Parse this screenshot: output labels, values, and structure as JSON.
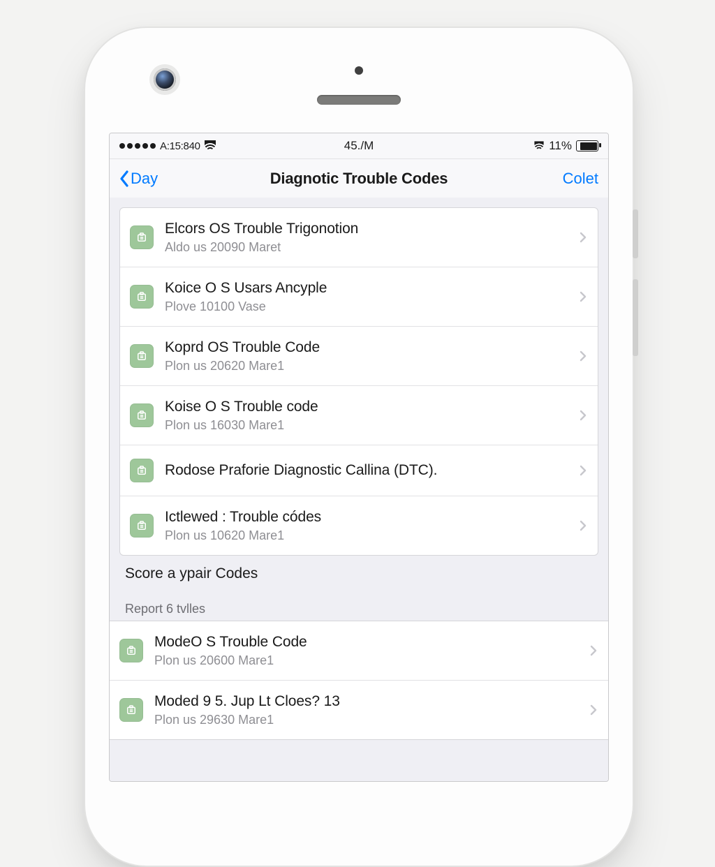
{
  "status": {
    "carrier": "A:15:840",
    "time": "45./M",
    "battery": "11%"
  },
  "nav": {
    "back": "Day",
    "title": "Diagnotic Trouble Codes",
    "right": "Colet"
  },
  "section1": {
    "items": [
      {
        "title": "Elcors OS Trouble Trigonotion",
        "subtitle": "Aldo us 20090 Maret"
      },
      {
        "title": "Koice O S Usars Ancyple",
        "subtitle": "Plove 10100 Vase"
      },
      {
        "title": "Koprd OS Trouble Code",
        "subtitle": "Plon us 20620 Mare1"
      },
      {
        "title": "Koise O S Trouble code",
        "subtitle": "Plon us 16030 Mare1"
      },
      {
        "title": "Rodose Praforie Diagnostic Callina (DTC)."
      },
      {
        "title": "Ictlewed : Trouble códes",
        "subtitle": "Plon us 10620 Mare1"
      }
    ],
    "link": "Score a ypair Codes"
  },
  "section2": {
    "header": "Report 6 tvlles",
    "items": [
      {
        "title": "ModeO S Trouble Code",
        "subtitle": "Plon us 20600 Mare1"
      },
      {
        "title": "Moded 9 5. Jup Lt Cloes? 13",
        "subtitle": "Plon us 29630 Mare1"
      }
    ]
  }
}
